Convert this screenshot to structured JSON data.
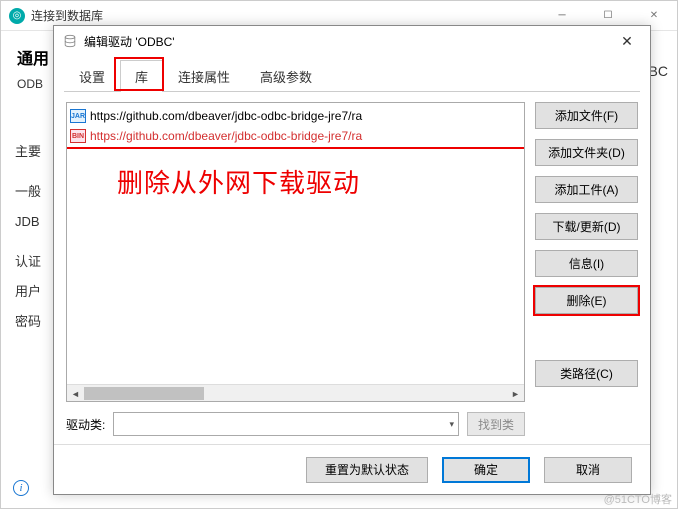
{
  "bg_window": {
    "title": "连接到数据库",
    "heading": "通用",
    "label_odb": "ODB",
    "side_main": "主要",
    "side_general": "一般",
    "side_jdb": "JDB",
    "side_auth": "认证",
    "side_user": "用户",
    "side_pwd": "密码",
    "odbc_hint": "ODBC"
  },
  "modal": {
    "title": "编辑驱动 'ODBC'",
    "tabs": {
      "settings": "设置",
      "library": "库",
      "conn_props": "连接属性",
      "adv_params": "高级参数"
    },
    "list_items": [
      {
        "kind": "JAR",
        "url": "https://github.com/dbeaver/jdbc-odbc-bridge-jre7/ra",
        "red": false
      },
      {
        "kind": "BIN",
        "url": "https://github.com/dbeaver/jdbc-odbc-bridge-jre7/ra",
        "red": true
      }
    ],
    "annotation": "删除从外网下载驱动",
    "driver_class_label": "驱动类:",
    "find_class": "找到类",
    "buttons": {
      "add_file": "添加文件(F)",
      "add_folder": "添加文件夹(D)",
      "add_artifact": "添加工件(A)",
      "download": "下载/更新(D)",
      "info": "信息(I)",
      "delete": "删除(E)",
      "classpath": "类路径(C)"
    },
    "footer": {
      "reset": "重置为默认状态",
      "ok": "确定",
      "cancel": "取消"
    }
  },
  "watermark": "@51CTO博客"
}
